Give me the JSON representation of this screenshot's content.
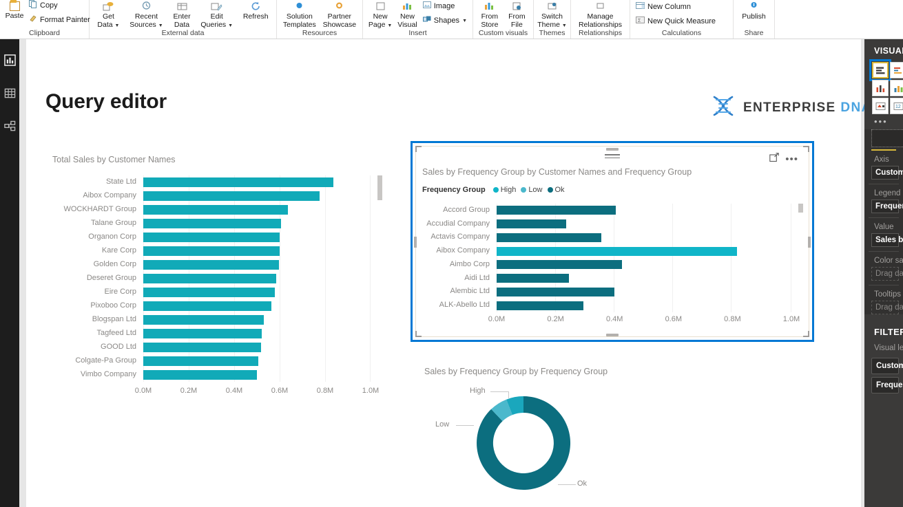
{
  "app": {
    "document_title": "Query editor"
  },
  "ribbon": {
    "groups": [
      {
        "name": "clipboard",
        "label": "Clipboard",
        "buttons": [
          {
            "id": "paste",
            "label": "Paste",
            "icon": "paste-icon",
            "kind": "large"
          }
        ],
        "small_buttons": [
          {
            "id": "copy",
            "label": "Copy",
            "icon": "copy-icon"
          },
          {
            "id": "format-painter",
            "label": "Format Painter",
            "icon": "format-painter-icon"
          }
        ]
      },
      {
        "name": "external-data",
        "label": "External data",
        "buttons": [
          {
            "id": "get-data",
            "label": "Get\nData",
            "line1": "Get",
            "line2": "Data",
            "icon": "get-data-icon",
            "caret": true
          },
          {
            "id": "recent-sources",
            "label": "Recent Sources",
            "line1": "Recent",
            "line2": "Sources",
            "icon": "recent-sources-icon",
            "caret": true
          },
          {
            "id": "enter-data",
            "label": "Enter Data",
            "line1": "Enter",
            "line2": "Data",
            "icon": "enter-data-icon",
            "caret": false
          },
          {
            "id": "edit-queries",
            "label": "Edit Queries",
            "line1": "Edit",
            "line2": "Queries",
            "icon": "edit-queries-icon",
            "caret": true
          },
          {
            "id": "refresh",
            "label": "Refresh",
            "line1": "Refresh",
            "line2": "",
            "icon": "refresh-icon",
            "caret": false
          }
        ]
      },
      {
        "name": "resources",
        "label": "Resources",
        "buttons": [
          {
            "id": "solution-templates",
            "label": "Solution Templates",
            "line1": "Solution",
            "line2": "Templates",
            "icon": "solution-templates-icon",
            "caret": false
          },
          {
            "id": "partner-showcase",
            "label": "Partner Showcase",
            "line1": "Partner",
            "line2": "Showcase",
            "icon": "partner-showcase-icon",
            "caret": false
          }
        ]
      },
      {
        "name": "insert",
        "label": "Insert",
        "buttons": [
          {
            "id": "new-page",
            "label": "New Page",
            "line1": "New",
            "line2": "Page",
            "icon": "new-page-icon",
            "caret": true
          },
          {
            "id": "new-visual",
            "label": "New Visual",
            "line1": "New",
            "line2": "Visual",
            "icon": "new-visual-icon",
            "caret": false
          }
        ],
        "small_buttons": [
          {
            "id": "image",
            "label": "Image",
            "icon": "image-icon"
          },
          {
            "id": "shapes",
            "label": "Shapes",
            "icon": "shapes-icon",
            "caret": true
          }
        ]
      },
      {
        "name": "custom-visuals",
        "label": "Custom visuals",
        "buttons": [
          {
            "id": "from-store",
            "label": "From Store",
            "line1": "From",
            "line2": "Store",
            "icon": "from-store-icon",
            "caret": false
          },
          {
            "id": "from-file",
            "label": "From File",
            "line1": "From",
            "line2": "File",
            "icon": "from-file-icon",
            "caret": false
          }
        ]
      },
      {
        "name": "themes",
        "label": "Themes",
        "buttons": [
          {
            "id": "switch-theme",
            "label": "Switch Theme",
            "line1": "Switch",
            "line2": "Theme",
            "icon": "switch-theme-icon",
            "caret": true
          }
        ]
      },
      {
        "name": "relationships",
        "label": "Relationships",
        "buttons": [
          {
            "id": "manage-relationships",
            "label": "Manage Relationships",
            "line1": "Manage",
            "line2": "Relationships",
            "icon": "manage-relationships-icon",
            "caret": false
          }
        ]
      },
      {
        "name": "calculations",
        "label": "Calculations",
        "small_buttons": [
          {
            "id": "new-column",
            "label": "New Column",
            "icon": "new-column-icon"
          },
          {
            "id": "new-quick-measure",
            "label": "New Quick Measure",
            "icon": "new-quick-measure-icon"
          }
        ]
      },
      {
        "name": "share",
        "label": "Share",
        "buttons": [
          {
            "id": "publish",
            "label": "Publish",
            "line1": "Publish",
            "line2": "",
            "icon": "publish-icon",
            "caret": false
          }
        ]
      }
    ]
  },
  "leftnav": {
    "items": [
      {
        "id": "report-view",
        "name": "report-view-icon",
        "title": "Report"
      },
      {
        "id": "data-view",
        "name": "data-view-icon",
        "title": "Data"
      },
      {
        "id": "model-view",
        "name": "model-view-icon",
        "title": "Model"
      }
    ]
  },
  "canvas": {
    "title": "Query editor",
    "logo": {
      "word1": "ENTERPRISE",
      "word2": "DNA"
    }
  },
  "colors": {
    "high": "#10b5c8",
    "low": "#4bb8cc",
    "ok": "#0c6e7f",
    "teal_main": "#11aab8",
    "selection": "#0078d4",
    "axis_text": "#8a8886"
  },
  "chart_data": [
    {
      "id": "total-sales-by-customer-names",
      "type": "bar",
      "orientation": "horizontal",
      "title": "Total Sales by Customer Names",
      "xlabel": "",
      "ylabel": "",
      "xlim": [
        0,
        1.0
      ],
      "xticks": [
        "0.0M",
        "0.2M",
        "0.4M",
        "0.6M",
        "0.8M",
        "1.0M"
      ],
      "xtick_values": [
        0,
        0.2,
        0.4,
        0.6,
        0.8,
        1.0
      ],
      "grid": true,
      "legend": "none",
      "series_color": "#11aab8",
      "categories": [
        "State Ltd",
        "Aibox Company",
        "WOCKHARDT Group",
        "Talane Group",
        "Organon Corp",
        "Kare Corp",
        "Golden Corp",
        "Deseret Group",
        "Eire Corp",
        "Pixoboo Corp",
        "Blogspan Ltd",
        "Tagfeed Ltd",
        "GOOD Ltd",
        "Colgate-Pa Group",
        "Vimbo Company"
      ],
      "values": [
        0.835,
        0.775,
        0.635,
        0.605,
        0.6,
        0.6,
        0.596,
        0.585,
        0.58,
        0.565,
        0.53,
        0.52,
        0.518,
        0.505,
        0.5
      ],
      "scrollbar": {
        "visible": true,
        "thumb_position": "top",
        "thumb_fraction": 0.12
      }
    },
    {
      "id": "sales-by-frequency-group-by-customer-names",
      "type": "bar",
      "orientation": "horizontal",
      "selected": true,
      "title": "Sales by Frequency Group by Customer Names and Frequency Group",
      "legend_title": "Frequency Group",
      "legend_position": "top",
      "legend_entries": [
        {
          "label": "High",
          "color": "#10b5c8"
        },
        {
          "label": "Low",
          "color": "#4bb8cc"
        },
        {
          "label": "Ok",
          "color": "#0c6e7f"
        }
      ],
      "xlim": [
        0,
        1.0
      ],
      "xticks": [
        "0.0M",
        "0.2M",
        "0.4M",
        "0.6M",
        "0.8M",
        "1.0M"
      ],
      "xtick_values": [
        0,
        0.2,
        0.4,
        0.6,
        0.8,
        1.0
      ],
      "grid": true,
      "categories": [
        "Accord Group",
        "Accudial Company",
        "Actavis Company",
        "Aibox Company",
        "Aimbo Corp",
        "Aidi Ltd",
        "Alembic Ltd",
        "ALK-Abello Ltd"
      ],
      "values": [
        0.405,
        0.235,
        0.355,
        0.815,
        0.425,
        0.245,
        0.4,
        0.295
      ],
      "point_groups": [
        "Ok",
        "Ok",
        "Ok",
        "High",
        "Ok",
        "Ok",
        "Ok",
        "Ok"
      ],
      "actions": {
        "focus_mode": "focus-mode-icon",
        "more_options": "..."
      },
      "scrollbar": {
        "visible": true,
        "thumb_position": "top",
        "thumb_fraction": 0.1
      }
    },
    {
      "id": "sales-by-frequency-group-donut",
      "type": "pie",
      "variant": "donut",
      "title": "Sales by Frequency Group by Frequency Group",
      "labels": [
        "High",
        "Low",
        "Ok"
      ],
      "values": [
        8,
        13,
        79
      ],
      "colors": [
        "#1aa7bd",
        "#4bb8cc",
        "#0c6e7f"
      ],
      "callouts": [
        {
          "label": "High",
          "position": "top-left"
        },
        {
          "label": "Low",
          "position": "left"
        },
        {
          "label": "Ok",
          "position": "bottom-right"
        }
      ]
    }
  ],
  "right_panel": {
    "header": "VISUALIZATIONS",
    "viz_icons": [
      {
        "name": "stacked-bar-chart-icon",
        "selected": true
      },
      {
        "name": "clustered-bar-chart-icon",
        "selected": false
      },
      {
        "name": "line-chart-icon",
        "selected": false
      },
      {
        "name": "area-chart-icon",
        "selected": false
      },
      {
        "name": "column-chart-icon",
        "selected": false
      },
      {
        "name": "ribbon-chart-icon",
        "selected": false
      },
      {
        "name": "waterfall-chart-icon",
        "selected": false
      },
      {
        "name": "funnel-chart-icon",
        "selected": false
      },
      {
        "name": "card-icon",
        "selected": false
      },
      {
        "name": "kpi-icon",
        "selected": false
      }
    ],
    "more_icon": "more-visuals-icon",
    "fields_tab": "fields-tab-icon",
    "field_wells": [
      {
        "label": "Axis",
        "value": "Customer Names",
        "placeholder": false
      },
      {
        "label": "Legend",
        "value": "Frequency Group",
        "placeholder": false
      },
      {
        "label": "Value",
        "value": "Sales by Frequency Group",
        "placeholder": false
      },
      {
        "label": "Color saturation",
        "value": "Drag data fields here",
        "placeholder": true
      },
      {
        "label": "Tooltips",
        "value": "Drag data fields here",
        "placeholder": true
      }
    ],
    "filters": {
      "header": "FILTERS",
      "sub": "Visual level filters",
      "cards": [
        "Customer Names",
        "Frequency Group"
      ]
    }
  }
}
